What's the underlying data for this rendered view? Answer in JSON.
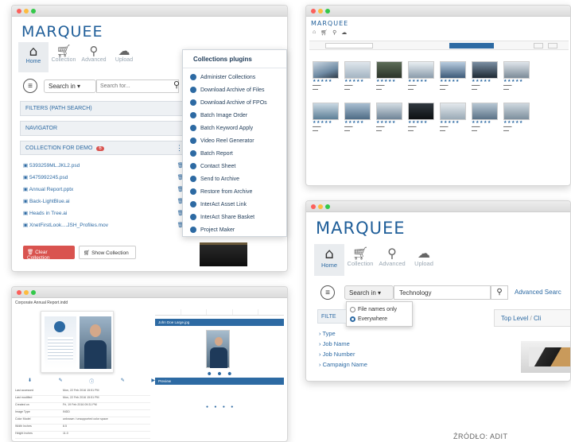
{
  "logo": "MARQUEE",
  "nav": {
    "home": "Home",
    "collection": "Collection",
    "advanced": "Advanced",
    "upload": "Upload"
  },
  "search": {
    "dropdown": "Search in",
    "placeholder": "Search for..."
  },
  "panels": {
    "filters": "FILTERS (PATH SEARCH)",
    "navigator": "NAVIGATOR",
    "collection_title": "COLLECTION FOR DEMO",
    "collection_count": "6"
  },
  "collection_files": [
    "5393259ML.JKL2.psd",
    "5475992245.psd",
    "Annual Report.pptx",
    "Back-LightBlue.ai",
    "Heads in Tree.ai",
    "XnetFirstLook....JSH_Profiles.mov"
  ],
  "buttons": {
    "clear": "Clear Collection",
    "show": "Show Collection"
  },
  "menu": {
    "title": "Collections plugins",
    "items": [
      "Administer Collections",
      "Download Archive of Files",
      "Download Archive of FPOs",
      "Batch Image Order",
      "Batch Keyword Apply",
      "Video Reel Generator",
      "Batch Report",
      "Contact Sheet",
      "Send to Archive",
      "Restore from Archive",
      "InterAct Asset Link",
      "InterAct Share Basket",
      "Project Maker"
    ]
  },
  "win4": {
    "search_value": "Technology",
    "advanced_link": "Advanced Searc",
    "filters_short": "FILTE",
    "options": [
      "File names only",
      "Everywhere"
    ],
    "selected_option": "Everywhere",
    "tree": [
      "Type",
      "Job Name",
      "Job Number",
      "Campaign Name"
    ],
    "breadcrumb": [
      "Top Level",
      "Cli"
    ]
  },
  "win3": {
    "title": "Corporate Annual Report.indd",
    "meta_rows": [
      [
        "Last accessed",
        "Mon, 22 Feb 2016 15:51 PM"
      ],
      [
        "Last modified",
        "Mon, 22 Feb 2016 15:51 PM"
      ],
      [
        "Created on",
        "Fri, 19 Feb 2016 09:31 PM"
      ],
      [
        "Image Type",
        "INDD"
      ],
      [
        "Color Model",
        "unknown / unsupported color space"
      ],
      [
        "Width Inches",
        "8.5"
      ],
      [
        "Height Inches",
        "11.0"
      ]
    ],
    "side_label_1": "John Doe Large.jpg",
    "side_label_2": "Preview"
  },
  "win2": {
    "logo": "MARQUEE"
  },
  "source": "ŹRÓDŁO: ADIT"
}
